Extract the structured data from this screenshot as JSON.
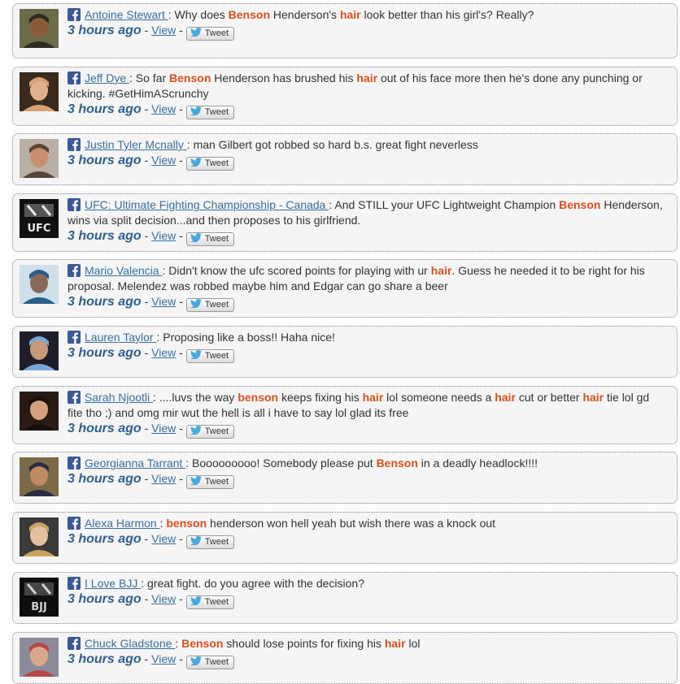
{
  "labels": {
    "view": "View",
    "tweet": "Tweet",
    "sep_colon": ": ",
    "sep_dash": " - "
  },
  "posts": [
    {
      "author": "Antoine Stewart ",
      "segments": [
        {
          "t": "Why does "
        },
        {
          "t": "Benson",
          "kw": true
        },
        {
          "t": " Henderson's "
        },
        {
          "t": "hair",
          "kw": true
        },
        {
          "t": " look better than his girl's? Really?"
        }
      ],
      "time": "3 hours ago",
      "avatar": {
        "bg": "#6b6b4a",
        "fg": "#2b2b22",
        "skin": "#8a5a3a"
      }
    },
    {
      "author": "Jeff Dye ",
      "segments": [
        {
          "t": "So far "
        },
        {
          "t": "Benson",
          "kw": true
        },
        {
          "t": " Henderson has brushed his "
        },
        {
          "t": "hair",
          "kw": true
        },
        {
          "t": " out of his face more then he's done any punching or kicking. #GetHimAScrunchy"
        }
      ],
      "time": "3 hours ago",
      "avatar": {
        "bg": "#3a2a1e",
        "fg": "#d9a078",
        "skin": "#e2b08c"
      }
    },
    {
      "author": "Justin Tyler Mcnally ",
      "segments": [
        {
          "t": "man Gilbert got robbed so hard b.s. great fight neverless"
        }
      ],
      "time": "3 hours ago",
      "avatar": {
        "bg": "#b8b0a4",
        "fg": "#5a4438",
        "skin": "#c89070"
      }
    },
    {
      "author": "UFC: Ultimate Fighting Championship - Canada ",
      "segments": [
        {
          "t": "And STILL your UFC Lightweight Champion "
        },
        {
          "t": "Benson",
          "kw": true
        },
        {
          "t": " Henderson, wins via split decision...and then proposes to his girlfriend."
        }
      ],
      "time": "3 hours ago",
      "avatar": {
        "bg": "#111111",
        "fg": "#e8e8e8",
        "skin": "#555555",
        "logo_text": "UFC"
      }
    },
    {
      "author": "Mario Valencia ",
      "segments": [
        {
          "t": "Didn't know the ufc scored points for playing with ur "
        },
        {
          "t": "hair",
          "kw": true
        },
        {
          "t": ". Guess he needed it to be right for his proposal. Melendez was robbed maybe him and Edgar can go share a beer"
        }
      ],
      "time": "3 hours ago",
      "avatar": {
        "bg": "#cfe0ea",
        "fg": "#2a5d8a",
        "skin": "#8a6a5a"
      }
    },
    {
      "author": "Lauren Taylor ",
      "segments": [
        {
          "t": "Proposing like a boss!! Haha nice!"
        }
      ],
      "time": "3 hours ago",
      "avatar": {
        "bg": "#1e1e2a",
        "fg": "#7aa8d8",
        "skin": "#c89a7a"
      }
    },
    {
      "author": "Sarah Njootli ",
      "segments": [
        {
          "t": "....luvs the way "
        },
        {
          "t": "benson",
          "kw": true
        },
        {
          "t": " keeps fixing his "
        },
        {
          "t": "hair",
          "kw": true
        },
        {
          "t": " lol someone needs a "
        },
        {
          "t": "hair",
          "kw": true
        },
        {
          "t": " cut or better "
        },
        {
          "t": "hair",
          "kw": true
        },
        {
          "t": " tie lol gd fite tho ;) and omg mir wut the hell is all i have to say lol glad its free"
        }
      ],
      "time": "3 hours ago",
      "avatar": {
        "bg": "#2a1a14",
        "fg": "#1a0e0a",
        "skin": "#d4a080"
      }
    },
    {
      "author": "Georgianna Tarrant ",
      "segments": [
        {
          "t": "Booooooooo! Somebody please put "
        },
        {
          "t": "Benson",
          "kw": true
        },
        {
          "t": " in a deadly headlock!!!!"
        }
      ],
      "time": "3 hours ago",
      "avatar": {
        "bg": "#7a6a4a",
        "fg": "#2c2c44",
        "skin": "#c08a64"
      }
    },
    {
      "author": "Alexa Harmon ",
      "segments": [
        {
          "t": "benson",
          "kw": true
        },
        {
          "t": " henderson won hell yeah but wish there was a knock out"
        }
      ],
      "time": "3 hours ago",
      "avatar": {
        "bg": "#3a3a3a",
        "fg": "#c8a460",
        "skin": "#e4c0a0"
      }
    },
    {
      "author": "I Love BJJ ",
      "segments": [
        {
          "t": "great fight. do you agree with the decision?"
        }
      ],
      "time": "3 hours ago",
      "avatar": {
        "bg": "#0e0e0e",
        "fg": "#cfcfcf",
        "skin": "#444444",
        "logo_text": "BJJ"
      }
    },
    {
      "author": "Chuck Gladstone ",
      "segments": [
        {
          "t": "Benson",
          "kw": true
        },
        {
          "t": " should lose points for fixing his "
        },
        {
          "t": "hair",
          "kw": true
        },
        {
          "t": " lol"
        }
      ],
      "time": "3 hours ago",
      "avatar": {
        "bg": "#8a8a9a",
        "fg": "#b84848",
        "skin": "#d8a888"
      }
    }
  ]
}
